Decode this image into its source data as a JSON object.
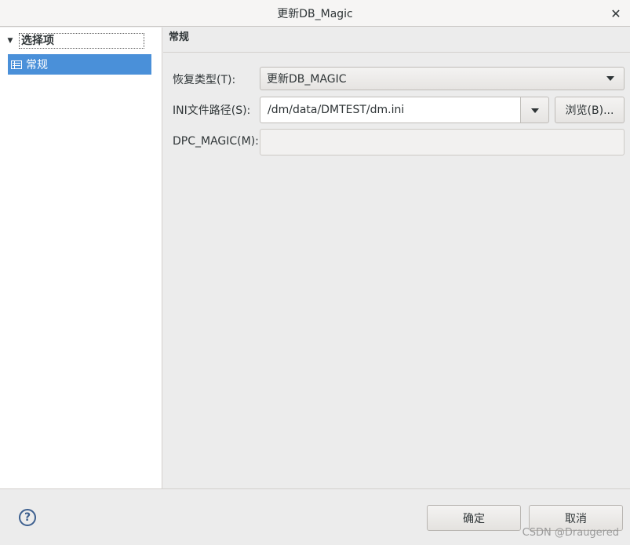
{
  "window": {
    "title": "更新DB_Magic",
    "close_glyph": "✕"
  },
  "sidebar": {
    "root_label": "选择项",
    "items": [
      {
        "label": "常规",
        "selected": true
      }
    ]
  },
  "main": {
    "section_title": "常规",
    "restore_type": {
      "label": "恢复类型(T):",
      "value": "更新DB_MAGIC"
    },
    "ini_path": {
      "label": "INI文件路径(S):",
      "value": "/dm/data/DMTEST/dm.ini",
      "browse_label": "浏览(B)..."
    },
    "dpc_magic": {
      "label": "DPC_MAGIC(M):",
      "value": ""
    }
  },
  "footer": {
    "help_glyph": "?",
    "ok_label": "确定",
    "cancel_label": "取消"
  },
  "watermark": "CSDN @Draugered",
  "colors": {
    "selection": "#4a90d9",
    "background": "#ececec"
  }
}
